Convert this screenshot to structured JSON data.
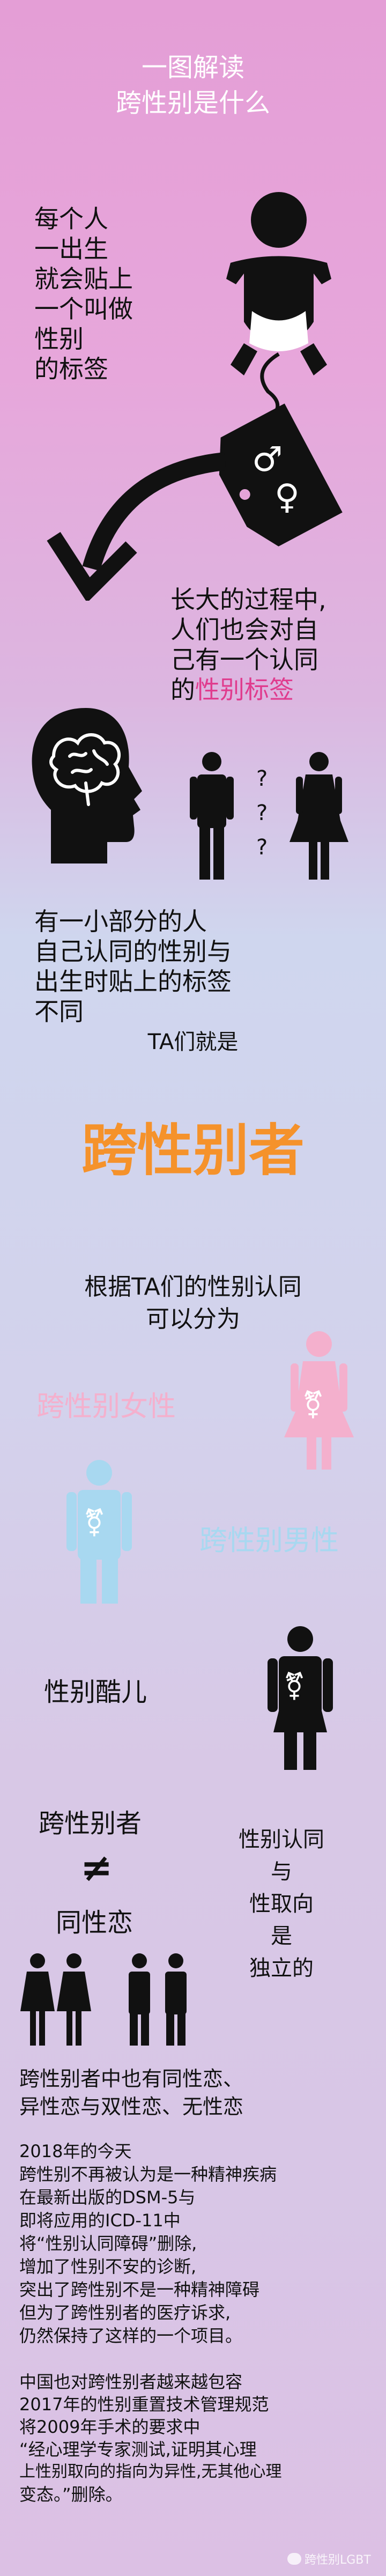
{
  "header": {
    "title_line1": "一图解读",
    "title_line2": "跨性别是什么"
  },
  "section1": {
    "lines": [
      "每个人",
      "一出生",
      "就会贴上",
      "一个叫做",
      "性别",
      "的标签"
    ]
  },
  "tag": {
    "male_symbol": "♂",
    "female_symbol": "♀"
  },
  "section2": {
    "line1": "长大的过程中,",
    "line2": "人们也会对自",
    "line3": "己有一个认同",
    "line4_prefix": "的",
    "line4_highlight": "性别标签"
  },
  "question_marks": [
    "?",
    "?",
    "?"
  ],
  "section3": {
    "lines": [
      "有一小部分的人",
      "自己认同的性别与",
      "出生时贴上的标签",
      "不同"
    ]
  },
  "ta": {
    "label": "TA们就是"
  },
  "big_title": {
    "text": "跨性别者"
  },
  "classify": {
    "line1": "根据TA们的性别认同",
    "line2": "可以分为"
  },
  "types": {
    "trans_woman": "跨性别女性",
    "trans_man": "跨性别男性",
    "genderqueer": "性别酷儿"
  },
  "colors": {
    "trans_woman": "#f4b0cd",
    "trans_man": "#a8d8f0",
    "highlight": "#e03c8e",
    "big_title": "#f5922b"
  },
  "compare": {
    "left_top": "跨性别者",
    "not_equal": "≠",
    "left_bottom": "同性恋",
    "right_lines": [
      "性别认同",
      "与",
      "性取向",
      "是",
      "独立的"
    ]
  },
  "orientation": {
    "line1": "跨性别者中也有同性恋、",
    "line2": "异性恋与双性恋、无性恋"
  },
  "news1": {
    "lines": [
      "2018年的今天",
      "跨性别不再被认为是一种精神疾病",
      "在最新出版的DSM-5与",
      "即将应用的ICD-11中",
      "将“性别认同障碍”删除,",
      "增加了性别不安的诊断,",
      "突出了跨性别不是一种精神障碍",
      "但为了跨性别者的医疗诉求,",
      "仍然保持了这样的一个项目。"
    ]
  },
  "news2": {
    "lines": [
      "中国也对跨性别者越来越包容",
      "2017年的性别重置技术管理规范",
      "将2009年手术的要求中",
      "“经心理学专家测试,证明其心理",
      "上性别取向的指向为异性,无其他心理",
      "变态。”删除。"
    ]
  },
  "watermark": {
    "text": "跨性别LGBT"
  }
}
